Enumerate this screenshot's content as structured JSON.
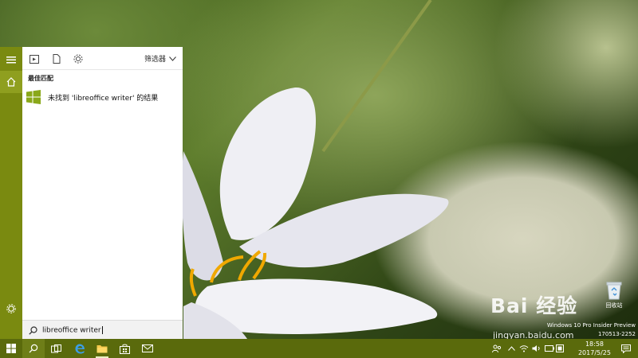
{
  "start_menu": {
    "filter_label": "筛选器",
    "section_title": "最佳匹配",
    "result_text": "未找到 'libreoffice writer' 的结果",
    "search_query": "libreoffice writer",
    "icons": {
      "menu": "hamburger-icon",
      "home": "home-icon",
      "settings": "gear-icon",
      "apps": "apps-icon",
      "documents": "document-icon",
      "web": "settings-icon",
      "search": "search-icon",
      "result": "windows-logo-icon"
    }
  },
  "desktop": {
    "recycle_bin_label": "回收站",
    "watermark_logo": "Bai 经验",
    "watermark_url": "jingyan.baidu.com",
    "build_line1": "Windows 10 Pro Insider Preview",
    "build_line2": "170513-2252"
  },
  "taskbar": {
    "time": "18:58",
    "date": "2017/5/25",
    "colors": {
      "accent": "#7a8a10",
      "taskbar": "#5a6a0c"
    }
  }
}
